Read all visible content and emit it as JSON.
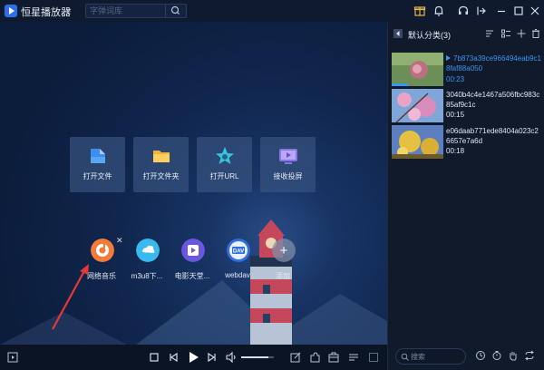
{
  "app": {
    "title": "恒星播放器",
    "title_chevron": "⌄"
  },
  "search": {
    "placeholder": "字弹词库"
  },
  "titlebar_icons": [
    "gift-icon",
    "bell-icon",
    "headset-icon",
    "pin-icon",
    "minimize-icon",
    "maximize-icon",
    "close-icon"
  ],
  "tiles": [
    {
      "label": "打开文件",
      "icon": "file-icon"
    },
    {
      "label": "打开文件夹",
      "icon": "folder-icon"
    },
    {
      "label": "打开URL",
      "icon": "star-link-icon"
    },
    {
      "label": "接收投屏",
      "icon": "cast-icon"
    }
  ],
  "apps": [
    {
      "label": "网络音乐",
      "icon": "music-icon",
      "close": "✕"
    },
    {
      "label": "m3u8下...",
      "icon": "m3u8-icon"
    },
    {
      "label": "电影天堂...",
      "icon": "movie-icon"
    },
    {
      "label": "webdav",
      "icon": "webdav-icon",
      "badge": "DAV"
    },
    {
      "label": "添加",
      "icon": "add-icon",
      "glyph": "+"
    }
  ],
  "playlist": {
    "title": "默认分类(3)",
    "items": [
      {
        "name": "7b873a39ce966494eab9c18faf88a050",
        "duration": "00:23",
        "active": true
      },
      {
        "name": "3040b4c4e1467a506fbc983c85af9c1c",
        "duration": "00:15",
        "active": false
      },
      {
        "name": "e06daab771ede8404a023c26657e7a6d",
        "duration": "00:18",
        "active": false
      }
    ],
    "search_placeholder": "搜索"
  },
  "colors": {
    "accent": "#3a95f0",
    "background": "#0d1a33",
    "tile": "#36527e",
    "annotation_arrow": "#e53935"
  }
}
